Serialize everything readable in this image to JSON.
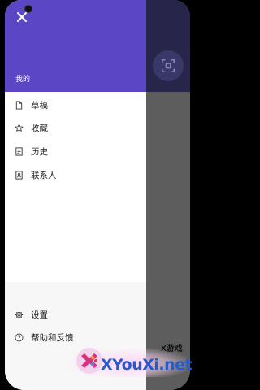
{
  "drawer": {
    "header": {
      "label": "我的"
    },
    "items": [
      {
        "label": "草稿",
        "icon": "draft-icon"
      },
      {
        "label": "收藏",
        "icon": "star-icon"
      },
      {
        "label": "历史",
        "icon": "history-icon"
      },
      {
        "label": "联系人",
        "icon": "contacts-icon"
      }
    ],
    "footer": [
      {
        "label": "设置",
        "icon": "gear-icon"
      },
      {
        "label": "帮助和反馈",
        "icon": "help-icon"
      }
    ]
  },
  "watermark": {
    "site": "XYouXi.net",
    "tag": "X游戏"
  },
  "colors": {
    "header": "#5b46c6",
    "app_top": "#27264a",
    "scrim": "#5d5d5d",
    "footer_bg": "#f7f7f7"
  }
}
